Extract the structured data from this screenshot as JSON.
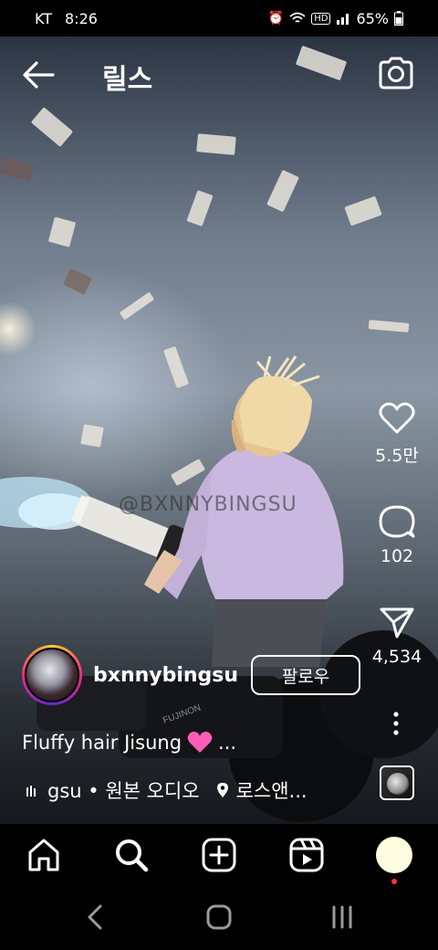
{
  "status_bar": {
    "carrier": "KT",
    "time": "8:26",
    "battery": "65%"
  },
  "header": {
    "title": "릴스"
  },
  "overlay": {
    "watermark": "@BXNNYBINGSU"
  },
  "actions": {
    "likes": "5.5만",
    "comments": "102",
    "shares": "4,534"
  },
  "profile": {
    "username": "bxnnybingsu",
    "follow_label": "팔로우"
  },
  "caption": {
    "text": "Fluffy hair Jisung",
    "more": "..."
  },
  "meta": {
    "audio": "gsu • 원본 오디오",
    "location": "로스앤..."
  },
  "colors": {
    "notification_dot": "#ff3040",
    "profile_circle": "#fffde0"
  }
}
